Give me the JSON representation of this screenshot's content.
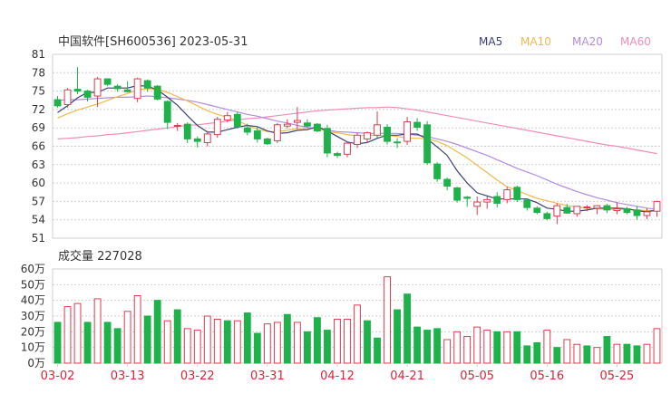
{
  "header": {
    "title": "中国软件[SH600536] 2023-05-31",
    "legend": [
      {
        "name": "MA5",
        "color": "#3a3f7a"
      },
      {
        "name": "MA10",
        "color": "#f2b94a"
      },
      {
        "name": "MA20",
        "color": "#b28be0"
      },
      {
        "name": "MA60",
        "color": "#f08dbb"
      }
    ]
  },
  "volume_panel": {
    "title": "成交量 227028"
  },
  "colors": {
    "up": "#e03a4f",
    "down": "#1fb14a",
    "grid": "#cfcfcf",
    "axis_text": "#333333",
    "date_text": "#d9263b"
  },
  "chart_data": [
    {
      "type": "candlestick",
      "yticks": [
        81,
        78,
        75,
        72,
        69,
        66,
        63,
        60,
        57,
        54,
        51
      ],
      "ylim": [
        51,
        81
      ],
      "dates": [
        "03-02",
        "03-03",
        "03-06",
        "03-07",
        "03-08",
        "03-09",
        "03-10",
        "03-13",
        "03-14",
        "03-15",
        "03-16",
        "03-17",
        "03-20",
        "03-21",
        "03-22",
        "03-23",
        "03-24",
        "03-27",
        "03-28",
        "03-29",
        "03-30",
        "03-31",
        "04-03",
        "04-04",
        "04-06",
        "04-07",
        "04-10",
        "04-11",
        "04-12",
        "04-13",
        "04-14",
        "04-17",
        "04-18",
        "04-19",
        "04-20",
        "04-21",
        "04-24",
        "04-25",
        "04-26",
        "04-27",
        "04-28",
        "05-04",
        "05-05",
        "05-08",
        "05-09",
        "05-10",
        "05-11",
        "05-12",
        "05-15",
        "05-16",
        "05-17",
        "05-18",
        "05-19",
        "05-22",
        "05-23",
        "05-24",
        "05-25",
        "05-26",
        "05-29",
        "05-30",
        "05-31"
      ],
      "xticks": [
        "03-02",
        "03-13",
        "03-22",
        "03-31",
        "04-12",
        "04-21",
        "05-05",
        "05-16",
        "05-25"
      ],
      "ohlc": [
        [
          73.6,
          74.2,
          72.3,
          72.6
        ],
        [
          72.8,
          75.5,
          72.3,
          75.2
        ],
        [
          75.3,
          78.9,
          74.5,
          75.0
        ],
        [
          75.0,
          75.2,
          73.3,
          74.0
        ],
        [
          74.2,
          77.3,
          72.4,
          77.0
        ],
        [
          77.0,
          77.1,
          75.8,
          76.1
        ],
        [
          75.8,
          76.1,
          74.9,
          75.4
        ],
        [
          75.2,
          76.6,
          74.8,
          74.9
        ],
        [
          73.8,
          77.2,
          73.2,
          77.0
        ],
        [
          76.7,
          76.9,
          74.9,
          75.5
        ],
        [
          75.8,
          76.0,
          73.5,
          73.7
        ],
        [
          73.3,
          73.5,
          68.8,
          69.9
        ],
        [
          69.3,
          69.8,
          68.5,
          69.4
        ],
        [
          69.6,
          69.9,
          66.5,
          67.2
        ],
        [
          67.2,
          67.6,
          65.8,
          66.8
        ],
        [
          66.6,
          68.5,
          66.0,
          68.0
        ],
        [
          67.9,
          70.8,
          67.4,
          70.4
        ],
        [
          70.3,
          71.6,
          69.9,
          71.0
        ],
        [
          71.2,
          71.6,
          68.9,
          69.2
        ],
        [
          69.0,
          69.7,
          67.8,
          68.3
        ],
        [
          68.5,
          69.2,
          66.6,
          67.2
        ],
        [
          67.2,
          67.4,
          66.2,
          66.4
        ],
        [
          66.9,
          69.8,
          66.5,
          69.5
        ],
        [
          69.3,
          70.4,
          68.9,
          69.6
        ],
        [
          69.9,
          72.4,
          68.8,
          70.2
        ],
        [
          69.8,
          70.4,
          69.1,
          69.3
        ],
        [
          69.6,
          69.8,
          68.3,
          68.5
        ],
        [
          68.9,
          69.5,
          64.2,
          64.9
        ],
        [
          64.8,
          65.1,
          64.1,
          64.5
        ],
        [
          64.7,
          66.7,
          64.2,
          66.5
        ],
        [
          66.3,
          68.2,
          65.7,
          67.8
        ],
        [
          67.2,
          68.4,
          66.5,
          68.2
        ],
        [
          67.8,
          71.7,
          67.4,
          69.5
        ],
        [
          69.1,
          69.6,
          66.3,
          66.8
        ],
        [
          66.7,
          67.3,
          65.7,
          66.6
        ],
        [
          66.8,
          70.8,
          66.2,
          70.0
        ],
        [
          69.9,
          70.6,
          68.5,
          69.1
        ],
        [
          69.5,
          70.1,
          63.0,
          63.3
        ],
        [
          63.1,
          63.4,
          60.2,
          60.7
        ],
        [
          60.6,
          60.9,
          58.8,
          59.5
        ],
        [
          59.2,
          59.4,
          56.8,
          57.2
        ],
        [
          57.7,
          57.9,
          56.1,
          57.5
        ],
        [
          56.2,
          57.8,
          54.8,
          56.9
        ],
        [
          56.9,
          57.8,
          55.8,
          57.3
        ],
        [
          57.8,
          58.5,
          56.0,
          56.7
        ],
        [
          57.3,
          59.4,
          56.7,
          58.9
        ],
        [
          59.3,
          59.6,
          56.9,
          57.3
        ],
        [
          57.2,
          57.5,
          55.5,
          56.0
        ],
        [
          55.9,
          56.2,
          54.9,
          55.2
        ],
        [
          55.0,
          55.3,
          53.9,
          54.2
        ],
        [
          54.6,
          56.7,
          53.3,
          56.3
        ],
        [
          56.0,
          56.6,
          55.0,
          55.1
        ],
        [
          55.0,
          56.2,
          54.5,
          56.2
        ],
        [
          56.0,
          56.4,
          55.4,
          56.1
        ],
        [
          55.9,
          56.4,
          54.9,
          56.3
        ],
        [
          56.3,
          56.6,
          55.1,
          55.6
        ],
        [
          55.5,
          56.9,
          54.9,
          55.8
        ],
        [
          55.8,
          56.1,
          54.9,
          55.2
        ],
        [
          55.6,
          56.2,
          54.0,
          54.7
        ],
        [
          54.7,
          55.9,
          54.1,
          55.3
        ],
        [
          55.4,
          57.1,
          54.5,
          57.0
        ]
      ],
      "ma5": [
        71.5,
        72.6,
        73.9,
        74.8,
        74.8,
        75.5,
        75.5,
        75.5,
        75.9,
        75.8,
        75.2,
        74.0,
        72.7,
        71.0,
        69.4,
        68.3,
        68.3,
        68.7,
        69.1,
        69.4,
        69.2,
        68.5,
        68.1,
        68.2,
        68.6,
        68.7,
        69.2,
        68.5,
        67.6,
        66.7,
        66.4,
        66.6,
        67.3,
        67.8,
        67.8,
        68.0,
        68.0,
        67.2,
        65.9,
        64.5,
        62.0,
        60.0,
        58.4,
        57.9,
        57.4,
        57.4,
        57.4,
        57.4,
        56.8,
        55.9,
        55.7,
        55.4,
        55.4,
        55.6,
        55.9,
        55.9,
        55.9,
        55.8,
        55.5,
        55.3,
        55.6
      ],
      "ma10": [
        70.6,
        71.3,
        71.9,
        72.4,
        72.9,
        73.5,
        74.1,
        74.6,
        75.2,
        75.4,
        75.3,
        74.8,
        74.1,
        73.4,
        72.6,
        71.8,
        71.2,
        70.7,
        70.2,
        69.4,
        68.8,
        68.4,
        68.4,
        68.6,
        68.9,
        68.9,
        68.9,
        68.4,
        68.2,
        67.9,
        67.7,
        67.8,
        67.8,
        67.8,
        67.6,
        67.3,
        67.3,
        67.2,
        66.8,
        66.1,
        65.1,
        64.1,
        62.9,
        61.7,
        60.5,
        59.4,
        58.8,
        58.1,
        57.5,
        57.1,
        56.7,
        56.3,
        56.1,
        55.9,
        55.8,
        55.7,
        55.7,
        55.7,
        55.6,
        55.5,
        55.5
      ],
      "ma20": [
        73.5,
        73.6,
        73.6,
        73.7,
        73.8,
        73.9,
        74.0,
        74.0,
        74.1,
        74.2,
        74.1,
        73.9,
        73.7,
        73.5,
        73.2,
        72.8,
        72.4,
        72.0,
        71.6,
        71.2,
        70.9,
        70.5,
        70.1,
        69.8,
        69.4,
        69.1,
        68.8,
        68.6,
        68.4,
        68.3,
        68.2,
        68.1,
        68.1,
        68.1,
        68.1,
        68.0,
        67.8,
        67.6,
        67.2,
        66.8,
        66.3,
        65.7,
        65.1,
        64.5,
        63.8,
        63.1,
        62.4,
        61.8,
        61.2,
        60.5,
        59.8,
        59.2,
        58.6,
        58.1,
        57.6,
        57.2,
        56.8,
        56.5,
        56.2,
        55.9,
        55.7
      ],
      "ma60": [
        67.2,
        67.3,
        67.4,
        67.6,
        67.7,
        67.9,
        68.0,
        68.2,
        68.4,
        68.6,
        68.8,
        69.0,
        69.2,
        69.4,
        69.5,
        69.7,
        69.9,
        70.1,
        70.3,
        70.5,
        70.6,
        70.8,
        71.0,
        71.2,
        71.4,
        71.6,
        71.8,
        71.9,
        72.0,
        72.1,
        72.2,
        72.3,
        72.3,
        72.4,
        72.3,
        72.1,
        71.9,
        71.6,
        71.3,
        71.0,
        70.7,
        70.4,
        70.1,
        69.8,
        69.5,
        69.2,
        68.9,
        68.6,
        68.3,
        68.0,
        67.7,
        67.4,
        67.1,
        66.8,
        66.5,
        66.2,
        66.0,
        65.7,
        65.4,
        65.1,
        64.8
      ]
    },
    {
      "type": "bar",
      "yticks": [
        "60万",
        "50万",
        "40万",
        "30万",
        "20万",
        "10万",
        "0万"
      ],
      "ylim": [
        0,
        60
      ],
      "unit": "万",
      "values": [
        26,
        36,
        38,
        26,
        41,
        26,
        22,
        33,
        43,
        30,
        40,
        27,
        34,
        22,
        21,
        30,
        28,
        27,
        27,
        32,
        19,
        25,
        26,
        31,
        26,
        20,
        29,
        21,
        28,
        28,
        37,
        27,
        16,
        55,
        34,
        44,
        23,
        21,
        22,
        15,
        20,
        17,
        23,
        21,
        20,
        20,
        20,
        11,
        13,
        21,
        10,
        15,
        12,
        11,
        10,
        17,
        12,
        12,
        11,
        12,
        22
      ],
      "directions": [
        "down",
        "up",
        "up",
        "down",
        "up",
        "down",
        "down",
        "up",
        "up",
        "down",
        "down",
        "up",
        "down",
        "up",
        "up",
        "up",
        "up",
        "down",
        "up",
        "down",
        "down",
        "up",
        "up",
        "down",
        "up",
        "down",
        "down",
        "down",
        "up",
        "up",
        "up",
        "down",
        "down",
        "up",
        "down",
        "down",
        "down",
        "down",
        "down",
        "up",
        "up",
        "up",
        "up",
        "up",
        "down",
        "up",
        "down",
        "down",
        "down",
        "up",
        "down",
        "up",
        "up",
        "down",
        "up",
        "down",
        "up",
        "down",
        "down",
        "up",
        "up"
      ]
    }
  ]
}
